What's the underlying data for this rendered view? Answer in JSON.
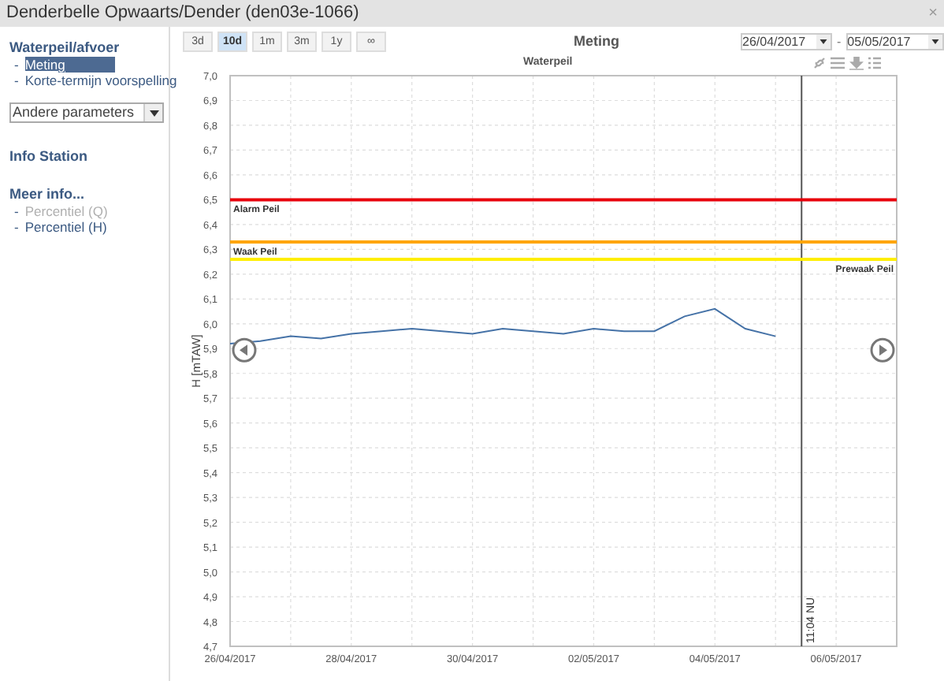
{
  "window": {
    "title": "Denderbelle Opwaarts/Dender (den03e-1066)",
    "close": "×"
  },
  "sidebar": {
    "sections": [
      {
        "title": "Waterpeil/afvoer",
        "items": [
          {
            "marker": "-",
            "label": "Meting",
            "selected": true,
            "disabled": false
          },
          {
            "marker": "-",
            "label": "Korte-termijn voorspelling",
            "selected": false,
            "disabled": false
          }
        ]
      }
    ],
    "dropdown": {
      "value": "Andere parameters"
    },
    "info_link": "Info Station",
    "more": {
      "title": "Meer info...",
      "items": [
        {
          "marker": "-",
          "label": "Percentiel (Q)",
          "selected": false,
          "disabled": true
        },
        {
          "marker": "-",
          "label": "Percentiel (H)",
          "selected": false,
          "disabled": false
        }
      ]
    }
  },
  "range_buttons": [
    {
      "label": "3d",
      "selected": false
    },
    {
      "label": "10d",
      "selected": true
    },
    {
      "label": "1m",
      "selected": false
    },
    {
      "label": "3m",
      "selected": false
    },
    {
      "label": "1y",
      "selected": false
    },
    {
      "label": "∞",
      "selected": false
    }
  ],
  "title": "Meting",
  "date_from": "26/04/2017",
  "date_separator": "-",
  "date_to": "05/05/2017",
  "chart": {
    "chart_data": {
      "type": "line",
      "title": "Waterpeil",
      "ylabel": "H [mTAW]",
      "ylim": [
        4.7,
        7.0
      ],
      "categories": [
        "26/04/2017",
        null,
        null,
        null,
        "28/04/2017",
        null,
        null,
        null,
        "30/04/2017",
        null,
        null,
        null,
        "02/05/2017",
        null,
        null,
        null,
        "04/05/2017",
        null,
        null,
        null,
        "06/05/2017",
        null,
        null
      ],
      "yticks": [
        {
          "value": 4.7,
          "label": "4,7"
        },
        {
          "value": 4.8,
          "label": "4,8"
        },
        {
          "value": 4.9,
          "label": "4,9"
        },
        {
          "value": 5.0,
          "label": "5,0"
        },
        {
          "value": 5.1,
          "label": "5,1"
        },
        {
          "value": 5.2,
          "label": "5,2"
        },
        {
          "value": 5.3,
          "label": "5,3"
        },
        {
          "value": 5.4,
          "label": "5,4"
        },
        {
          "value": 5.5,
          "label": "5,5"
        },
        {
          "value": 5.6,
          "label": "5,6"
        },
        {
          "value": 5.7,
          "label": "5,7"
        },
        {
          "value": 5.8,
          "label": "5,8"
        },
        {
          "value": 5.9,
          "label": "5,9"
        },
        {
          "value": 6.0,
          "label": "6,0"
        },
        {
          "value": 6.1,
          "label": "6,1"
        },
        {
          "value": 6.2,
          "label": "6,2"
        },
        {
          "value": 6.3,
          "label": "6,3"
        },
        {
          "value": 6.4,
          "label": "6,4"
        },
        {
          "value": 6.5,
          "label": "6,5"
        },
        {
          "value": 6.6,
          "label": "6,6"
        },
        {
          "value": 6.7,
          "label": "6,7"
        },
        {
          "value": 6.8,
          "label": "6,8"
        },
        {
          "value": 6.9,
          "label": "6,9"
        },
        {
          "value": 7.0,
          "label": "7,0"
        }
      ],
      "series": [
        {
          "color": "#4572a7",
          "values": [
            5.92,
            5.93,
            5.95,
            5.94,
            5.96,
            5.97,
            5.98,
            5.97,
            5.96,
            5.98,
            5.97,
            5.96,
            5.98,
            5.97,
            5.97,
            6.03,
            6.06,
            5.98,
            5.95,
            null,
            null,
            null,
            null
          ]
        }
      ],
      "ref_lines": [
        {
          "axis": "y",
          "value": 6.5,
          "label": "Alarm Peil",
          "color": "#e8000b"
        },
        {
          "axis": "y",
          "value": 6.33,
          "label": "Waak Peil",
          "color": "#ffa500"
        },
        {
          "axis": "y",
          "value": 6.26,
          "label": "Prewaak Peil",
          "color": "#ffee00"
        }
      ],
      "grid": true,
      "annotations": [
        "11:04 NU"
      ]
    }
  }
}
